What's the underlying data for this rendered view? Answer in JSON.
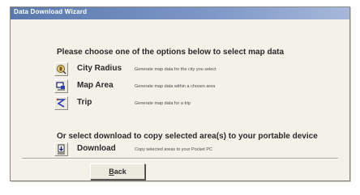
{
  "window": {
    "title": "Data Download Wizard"
  },
  "main": {
    "heading": "Please choose one of the options below to select map data",
    "options": [
      {
        "icon": "city-radius-icon",
        "label": "City Radius",
        "description": "Generate map data for the city you select"
      },
      {
        "icon": "map-area-icon",
        "label": "Map Area",
        "description": "Generate map data within a chosen area"
      },
      {
        "icon": "trip-icon",
        "label": "Trip",
        "description": "Generate map data for a trip"
      }
    ],
    "heading2": "Or select download to copy selected area(s) to your portable device",
    "download": {
      "icon": "download-icon",
      "label": "Download",
      "description": "Copy selected areas to your Pocket PC"
    }
  },
  "footer": {
    "back_label_first": "B",
    "back_label_rest": "ack"
  }
}
